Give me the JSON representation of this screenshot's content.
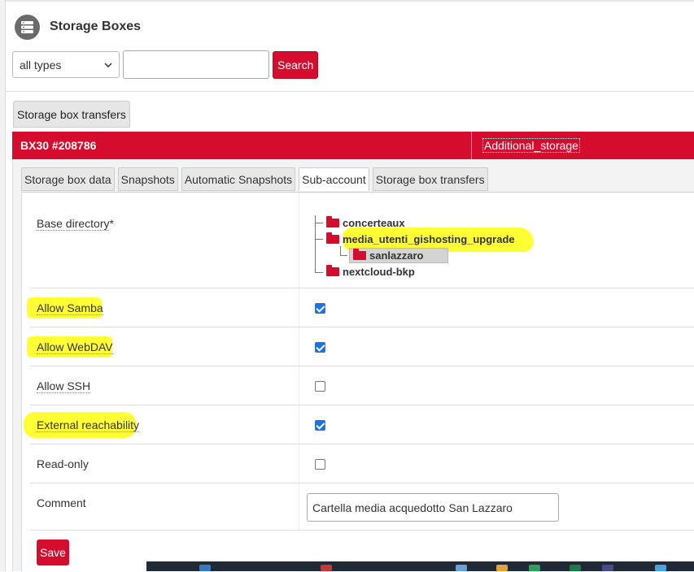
{
  "header": {
    "title": "Storage Boxes",
    "icon": "server-list-icon"
  },
  "filter": {
    "type_selected": "all types",
    "search_value": "",
    "search_label": "Search"
  },
  "transfers_button": "Storage box transfers",
  "box": {
    "id": "BX30 #208786",
    "name": "Additional_storage"
  },
  "tabs": [
    {
      "label": "Storage box data"
    },
    {
      "label": "Snapshots"
    },
    {
      "label": "Automatic Snapshots"
    },
    {
      "label": "Sub-account",
      "active": true
    },
    {
      "label": "Storage box transfers"
    }
  ],
  "form": {
    "base_directory_label": "Base directory",
    "required_marker": "*",
    "tree": {
      "n1": "concerteaux",
      "n2": "media_utenti_gishosting_upgrade",
      "n3": "sanlazzaro",
      "n4": "nextcloud-bkp"
    },
    "allow_samba": {
      "label": "Allow Samba",
      "checked": true
    },
    "allow_webdav": {
      "label": "Allow WebDAV",
      "checked": true
    },
    "allow_ssh": {
      "label": "Allow SSH",
      "checked": false
    },
    "external_reachability": {
      "label": "External reachability",
      "checked": true
    },
    "read_only": {
      "label": "Read-only",
      "checked": false
    },
    "comment": {
      "label": "Comment",
      "value": "Cartella media acquedotto San Lazzaro"
    },
    "save_label": "Save"
  },
  "colors": {
    "accent": "#d50c2d",
    "highlight": "#ffff33",
    "checkbox": "#1a73e8"
  }
}
